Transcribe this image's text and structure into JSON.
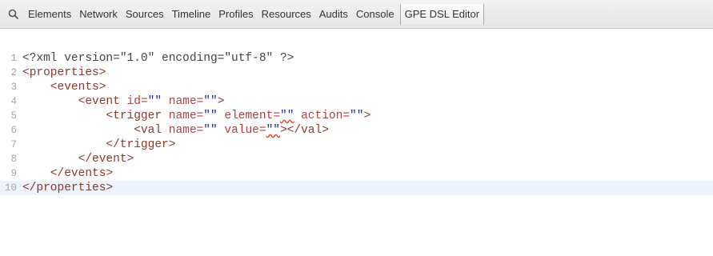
{
  "toolbar": {
    "search_icon": "search-icon",
    "tabs": [
      "Elements",
      "Network",
      "Sources",
      "Timeline",
      "Profiles",
      "Resources",
      "Audits",
      "Console",
      "GPE DSL Editor"
    ],
    "active_tab": "GPE DSL Editor"
  },
  "editor": {
    "current_line": 10,
    "lines": [
      {
        "num": "1",
        "text": "<?xml version=\"1.0\" encoding=\"utf-8\" ?>"
      },
      {
        "num": "2",
        "text": "<properties>"
      },
      {
        "num": "3",
        "text": "    <events>"
      },
      {
        "num": "4",
        "text": "        <event id=\"\" name=\"\">"
      },
      {
        "num": "5",
        "text": "            <trigger name=\"\" element=\"\" action=\"\">"
      },
      {
        "num": "6",
        "text": "                <val name=\"\" value=\"\"></val>"
      },
      {
        "num": "7",
        "text": "            </trigger>"
      },
      {
        "num": "8",
        "text": "        </event>"
      },
      {
        "num": "9",
        "text": "    </events>"
      },
      {
        "num": "10",
        "text": "</properties>"
      }
    ]
  }
}
